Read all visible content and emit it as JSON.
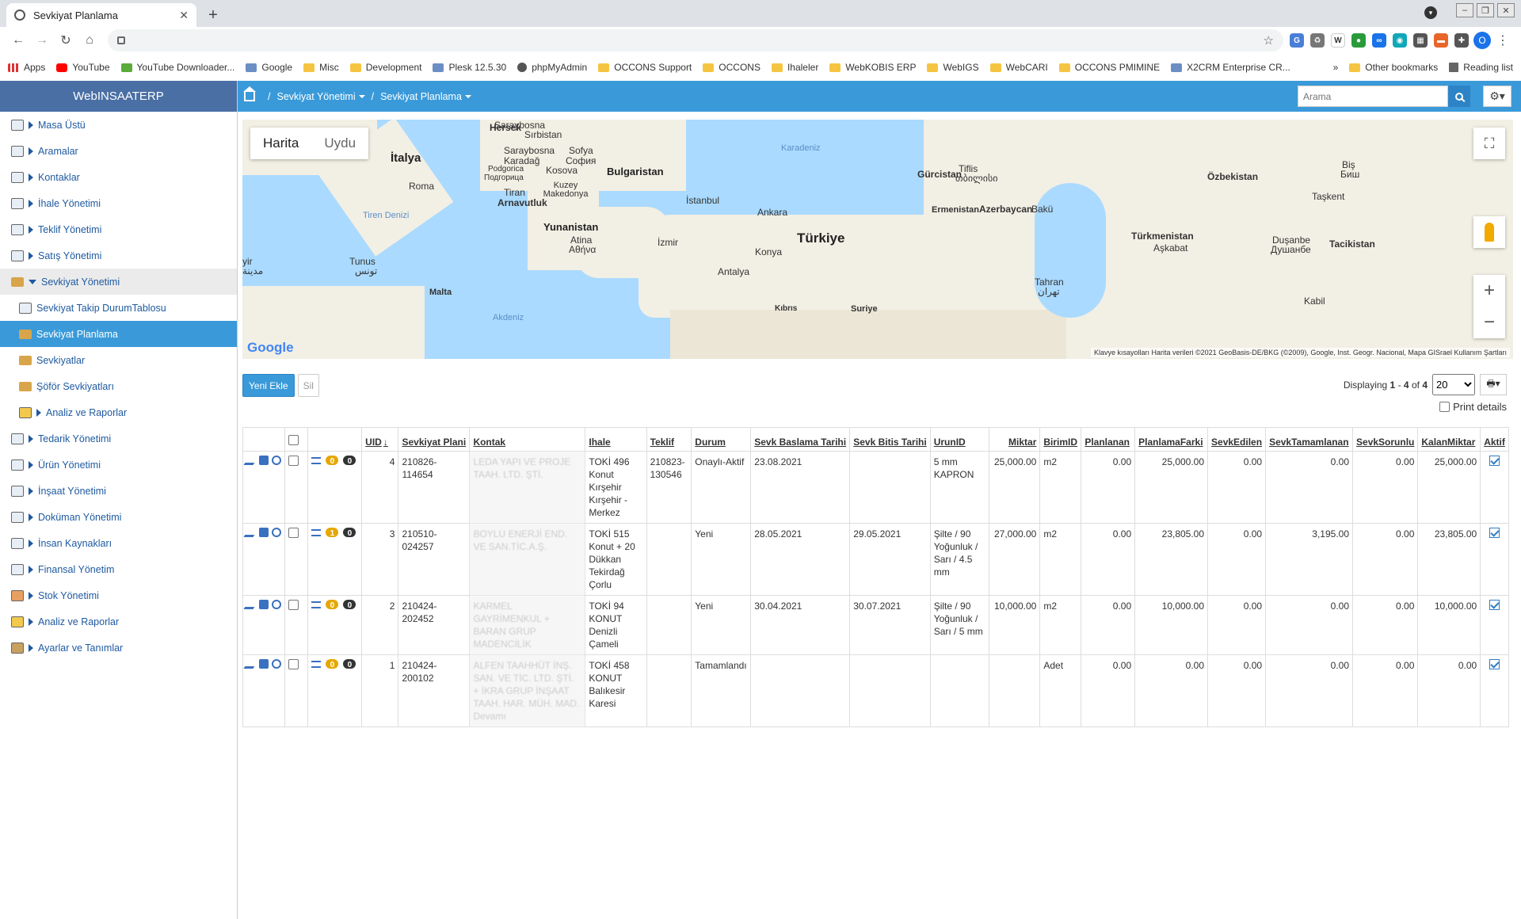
{
  "browser": {
    "tab_title": "Sevkiyat Planlama",
    "bookmarks": [
      "Apps",
      "YouTube",
      "YouTube Downloader...",
      "Google",
      "Misc",
      "Development",
      "Plesk 12.5.30",
      "phpMyAdmin",
      "OCCONS Support",
      "OCCONS",
      "Ihaleler",
      "WebKOBIS ERP",
      "WebIGS",
      "WebCARI",
      "OCCONS PMIMINE",
      "X2CRM Enterprise CR..."
    ],
    "other_bookmarks": "Other bookmarks",
    "reading_list": "Reading list",
    "profile_initial": "O"
  },
  "sidebar": {
    "brand": "WebINSAATERP",
    "items": [
      {
        "label": "Masa Üstü"
      },
      {
        "label": "Aramalar"
      },
      {
        "label": "Kontaklar"
      },
      {
        "label": "İhale Yönetimi"
      },
      {
        "label": "Teklif Yönetimi"
      },
      {
        "label": "Satış Yönetimi"
      },
      {
        "label": "Sevkiyat Yönetimi"
      },
      {
        "label": "Sevkiyat Takip DurumTablosu"
      },
      {
        "label": "Sevkiyat Planlama"
      },
      {
        "label": "Sevkiyatlar"
      },
      {
        "label": "Şöför Sevkiyatları"
      },
      {
        "label": "Analiz ve Raporlar"
      },
      {
        "label": "Tedarik Yönetimi"
      },
      {
        "label": "Ürün Yönetimi"
      },
      {
        "label": "İnşaat Yönetimi"
      },
      {
        "label": "Doküman Yönetimi"
      },
      {
        "label": "İnsan Kaynakları"
      },
      {
        "label": "Finansal Yönetim"
      },
      {
        "label": "Stok Yönetimi"
      },
      {
        "label": "Analiz ve Raporlar"
      },
      {
        "label": "Ayarlar ve Tanımlar"
      }
    ]
  },
  "header": {
    "crumb1": "Sevkiyat Yönetimi",
    "crumb2": "Sevkiyat Planlama",
    "search_placeholder": "Arama"
  },
  "map": {
    "btn_map": "Harita",
    "btn_sat": "Uydu",
    "labels": {
      "italy": "İtalya",
      "rome": "Roma",
      "bulgaria": "Bulgaristan",
      "sofia": "Sofya",
      "sofia_cyr": "София",
      "kosovo": "Kosova",
      "serbia": "Sırbistan",
      "bosnia": "Saraybosna",
      "hersek": "Hersek",
      "karadag": "Karadağ",
      "podgorica": "Podgorica",
      "podgorica_cyr": "Подгорица",
      "tirana": "Tiran",
      "albania": "Arnavutluk",
      "macedonia": "Kuzey Makedonya",
      "greece": "Yunanistan",
      "athens": "Atina",
      "athens_gr": "Αθήνα",
      "istanbul": "İstanbul",
      "izmir": "İzmir",
      "ankara": "Ankara",
      "turkiye": "Türkiye",
      "konya": "Konya",
      "antalya": "Antalya",
      "tyrrhen": "Tiren Denizi",
      "tunus": "Tunus",
      "tunus_ar": "تونس",
      "malta": "Malta",
      "akdeniz": "Akdeniz",
      "kibris": "Kıbrıs",
      "suriye": "Suriye",
      "karadeniz": "Karadeniz",
      "georgia": "Gürcistan",
      "tiflis": "Tiflis",
      "tiflis_ka": "თბილისი",
      "armenia": "Ermenistan",
      "azerbaijan": "Azerbaycan",
      "baku": "Bakü",
      "tahran": "Tahran",
      "tahran_fa": "تهران",
      "turkmen": "Türkmenistan",
      "askabat": "Aşkabat",
      "uzbek": "Özbekistan",
      "taskent": "Taşkent",
      "dusanbe": "Duşanbe",
      "dusanbe_cyr": "Душанбе",
      "tacik": "Tacikistan",
      "kabil": "Kabil",
      "bis": "Biş",
      "bis_cyr": "Биш",
      "yir": "yir",
      "yir_ar": "مدينة"
    },
    "google": "Google",
    "attribution": "Klavye kısayolları    Harita verileri ©2021 GeoBasis-DE/BKG (©2009), Google, Inst. Geogr. Nacional, Mapa GISrael    Kullanım Şartları"
  },
  "actions": {
    "add": "Yeni Ekle",
    "delete": "Sil"
  },
  "paging": {
    "text_pre": "Displaying",
    "from": "1",
    "sep": "-",
    "to": "4",
    "of": "of",
    "total": "4",
    "page_size": "20",
    "print_details": "Print details"
  },
  "table": {
    "headers": [
      "UID",
      "Sevkiyat Plani",
      "Kontak",
      "Ihale",
      "Teklif",
      "Durum",
      "Sevk Baslama Tarihi",
      "Sevk Bitis Tarihi",
      "UrunID",
      "Miktar",
      "BirimID",
      "Planlanan",
      "PlanlamaFarki",
      "SevkEdilen",
      "SevkTamamlanan",
      "SevkSorunlu",
      "KalanMiktar",
      "Aktif"
    ],
    "rows": [
      {
        "b1": "0",
        "b2": "0",
        "uid": "4",
        "plan": "210826-114654",
        "kontak": "LEDA YAPI VE PROJE TAAH. LTD. ŞTİ.",
        "ihale": "TOKİ 496 Konut Kırşehir Kırşehir - Merkez",
        "teklif": "210823-130546",
        "durum": "Onaylı-Aktif",
        "bas": "23.08.2021",
        "bit": "",
        "urun": "5 mm KAPRON",
        "miktar": "25,000.00",
        "birim": "m2",
        "planlanan": "0.00",
        "fark": "25,000.00",
        "edilen": "0.00",
        "tamam": "0.00",
        "sorunlu": "0.00",
        "kalan": "25,000.00"
      },
      {
        "b1": "1",
        "b2": "0",
        "uid": "3",
        "plan": "210510-024257",
        "kontak": "BOYLU ENERJİ END. VE SAN.TİC.A.Ş.",
        "ihale": "TOKİ 515 Konut + 20 Dükkan Tekirdağ Çorlu",
        "teklif": "",
        "durum": "Yeni",
        "bas": "28.05.2021",
        "bit": "29.05.2021",
        "urun": "Şilte / 90 Yoğunluk / Sarı / 4.5 mm",
        "miktar": "27,000.00",
        "birim": "m2",
        "planlanan": "0.00",
        "fark": "23,805.00",
        "edilen": "0.00",
        "tamam": "3,195.00",
        "sorunlu": "0.00",
        "kalan": "23,805.00"
      },
      {
        "b1": "0",
        "b2": "0",
        "uid": "2",
        "plan": "210424-202452",
        "kontak": "KARMEL GAYRİMENKUL + BARAN GRUP MADENCİLİK",
        "ihale": "TOKİ 94 KONUT Denizli Çameli",
        "teklif": "",
        "durum": "Yeni",
        "bas": "30.04.2021",
        "bit": "30.07.2021",
        "urun": "Şilte / 90 Yoğunluk / Sarı / 5 mm",
        "miktar": "10,000.00",
        "birim": "m2",
        "planlanan": "0.00",
        "fark": "10,000.00",
        "edilen": "0.00",
        "tamam": "0.00",
        "sorunlu": "0.00",
        "kalan": "10,000.00"
      },
      {
        "b1": "0",
        "b2": "0",
        "uid": "1",
        "plan": "210424-200102",
        "kontak": "ALFEN TAAHHÜT İNŞ. SAN. VE TİC. LTD. ŞTİ. + İKRA GRUP İNŞAAT TAAH. HAR. MÜH. MAD. Devamı",
        "ihale": "TOKİ 458 KONUT Balıkesir Karesi",
        "teklif": "",
        "durum": "Tamamlandı",
        "bas": "",
        "bit": "",
        "urun": "",
        "miktar": "",
        "birim": "Adet",
        "planlanan": "0.00",
        "fark": "0.00",
        "edilen": "0.00",
        "tamam": "0.00",
        "sorunlu": "0.00",
        "kalan": "0.00"
      }
    ]
  }
}
